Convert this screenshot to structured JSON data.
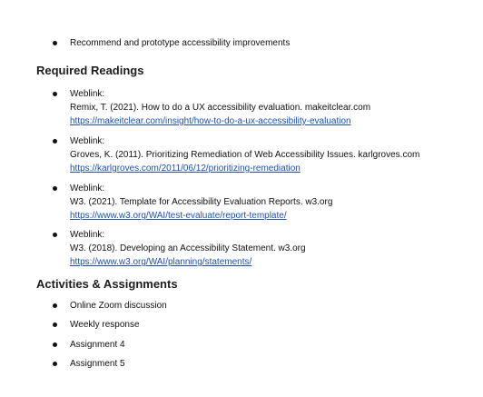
{
  "top_bullet": "Recommend and prototype accessibility improvements",
  "required_readings": {
    "heading": "Required Readings",
    "items": [
      {
        "label": "Weblink:",
        "citation": "Remix, T. (2021). How to do a UX accessibility evaluation. makeitclear.com",
        "url": "https://makeitclear.com/insight/how-to-do-a-ux-accessibility-evaluation"
      },
      {
        "label": "Weblink:",
        "citation": "Groves, K. (2011). Prioritizing Remediation of Web Accessibility Issues. karlgroves.com",
        "url": "https://karlgroves.com/2011/06/12/prioritizing-remediation"
      },
      {
        "label": "Weblink:",
        "citation": "W3. (2021). Template for Accessibility Evaluation Reports. w3.org",
        "url": "https://www.w3.org/WAI/test-evaluate/report-template/"
      },
      {
        "label": "Weblink:",
        "citation": "W3. (2018). Developing an Accessibility Statement. w3.org",
        "url": "https://www.w3.org/WAI/planning/statements/"
      }
    ]
  },
  "activities": {
    "heading": "Activities & Assignments",
    "items": [
      "Online Zoom discussion",
      "Weekly response",
      "Assignment 4",
      "Assignment 5"
    ]
  },
  "colors": {
    "link": "#1f4fa8",
    "text": "#111111"
  }
}
